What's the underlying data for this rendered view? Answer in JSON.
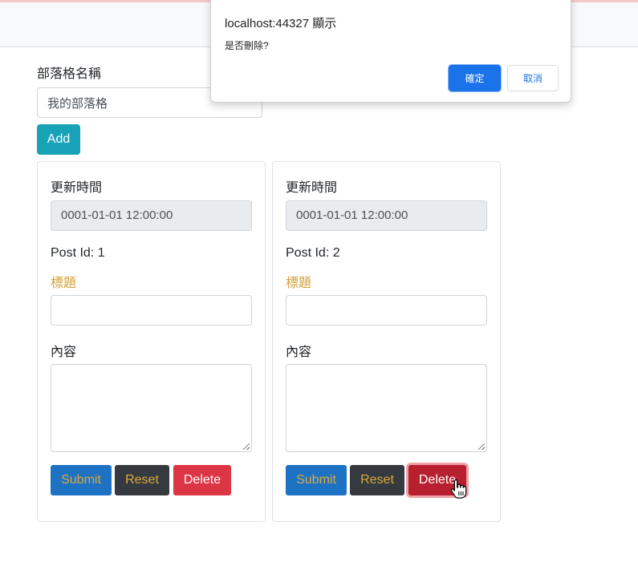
{
  "form": {
    "blog_name_label": "部落格名稱",
    "blog_name_value": "我的部落格",
    "add_label": "Add"
  },
  "posts": [
    {
      "updated_label": "更新時間",
      "updated_value": "0001-01-01 12:00:00",
      "post_id_text": "Post Id: 1",
      "title_label": "標題",
      "title_value": "",
      "content_label": "內容",
      "content_value": "",
      "submit_label": "Submit",
      "reset_label": "Reset",
      "delete_label": "Delete"
    },
    {
      "updated_label": "更新時間",
      "updated_value": "0001-01-01 12:00:00",
      "post_id_text": "Post Id: 2",
      "title_label": "標題",
      "title_value": "",
      "content_label": "內容",
      "content_value": "",
      "submit_label": "Submit",
      "reset_label": "Reset",
      "delete_label": "Delete"
    }
  ],
  "dialog": {
    "title": "localhost:44327 顯示",
    "message": "是否刪除?",
    "ok_label": "確定",
    "cancel_label": "取消"
  },
  "colors": {
    "add_button": "#17a2b8",
    "submit_button": "#1d72c4",
    "reset_button": "#343a40",
    "delete_button": "#dc3545",
    "title_label": "#d4a03a",
    "dialog_ok": "#1a73e8"
  }
}
